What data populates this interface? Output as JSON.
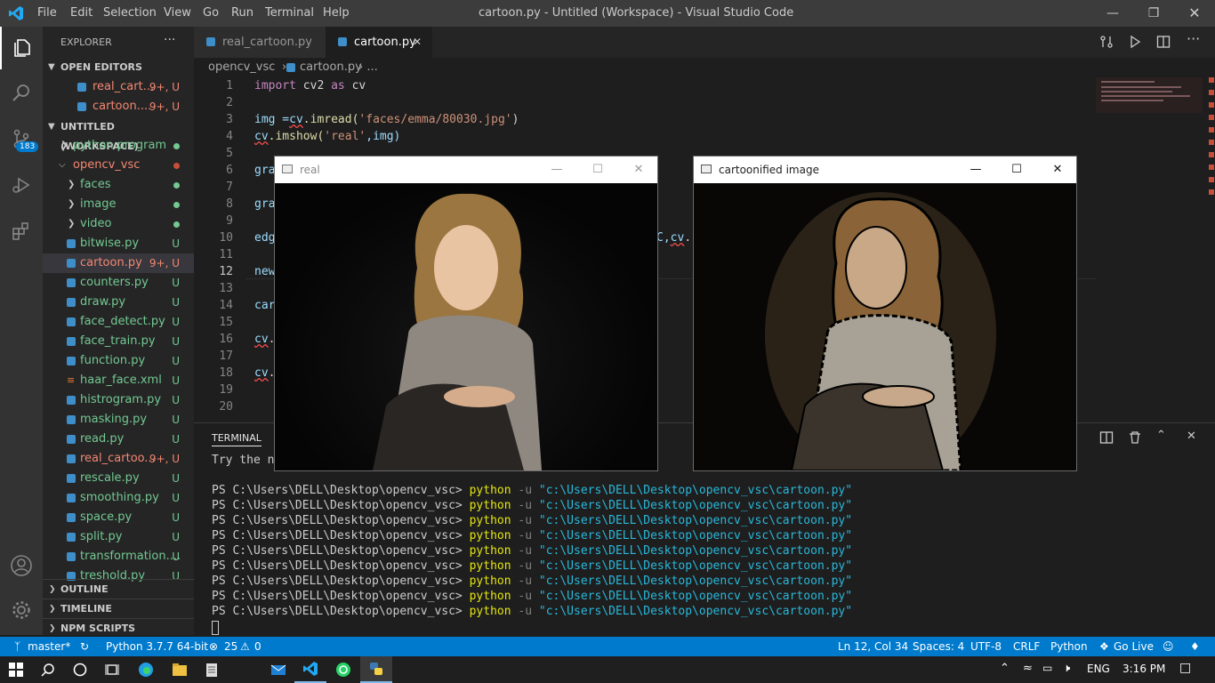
{
  "titlebar": {
    "menus": [
      "File",
      "Edit",
      "Selection",
      "View",
      "Go",
      "Run",
      "Terminal",
      "Help"
    ],
    "title": "cartoon.py - Untitled (Workspace) - Visual Studio Code"
  },
  "activity": {
    "scm_badge": "183"
  },
  "sidebar": {
    "explorer_title": "EXPLORER",
    "explorer_more": "···",
    "open_editors_title": "OPEN EDITORS",
    "open_editors": [
      {
        "name": "real_cart...",
        "status": "9+, U"
      },
      {
        "name": "cartoon....",
        "status": "9+, U"
      }
    ],
    "workspace_title": "UNTITLED (WORKSPACE)",
    "folders": [
      {
        "name": "python program"
      },
      {
        "name": "opencv_vsc"
      },
      {
        "name": "faces"
      },
      {
        "name": "image"
      },
      {
        "name": "video"
      }
    ],
    "files": [
      {
        "name": "bitwise.py",
        "status": "U"
      },
      {
        "name": "cartoon.py",
        "status": "9+, U"
      },
      {
        "name": "counters.py",
        "status": "U"
      },
      {
        "name": "draw.py",
        "status": "U"
      },
      {
        "name": "face_detect.py",
        "status": "U"
      },
      {
        "name": "face_train.py",
        "status": "U"
      },
      {
        "name": "function.py",
        "status": "U"
      },
      {
        "name": "haar_face.xml",
        "status": "U"
      },
      {
        "name": "histrogram.py",
        "status": "U"
      },
      {
        "name": "masking.py",
        "status": "U"
      },
      {
        "name": "read.py",
        "status": "U"
      },
      {
        "name": "real_cartoo...",
        "status": "9+, U"
      },
      {
        "name": "rescale.py",
        "status": "U"
      },
      {
        "name": "smoothing.py",
        "status": "U"
      },
      {
        "name": "space.py",
        "status": "U"
      },
      {
        "name": "split.py",
        "status": "U"
      },
      {
        "name": "transformation....",
        "status": "U"
      },
      {
        "name": "treshold.py",
        "status": "U"
      }
    ],
    "outline": "OUTLINE",
    "timeline": "TIMELINE",
    "npm": "NPM SCRIPTS"
  },
  "tabs": [
    {
      "name": "real_cartoon.py"
    },
    {
      "name": "cartoon.py",
      "close": "✕"
    }
  ],
  "breadcrumb": {
    "folder": "opencv_vsc",
    "sep": "›",
    "file": "cartoon.py",
    "tail": "›  ..."
  },
  "editor": {
    "line_numbers": [
      "1",
      "2",
      "3",
      "4",
      "5",
      "6",
      "7",
      "8",
      "9",
      "10",
      "11",
      "12",
      "13",
      "14",
      "15",
      "16",
      "17",
      "18",
      "19",
      "20"
    ],
    "line1": {
      "kw1": "import",
      "mod": " cv2 ",
      "kw2": "as",
      "alias": " cv"
    },
    "line3": {
      "pre": "img =",
      "cv": "cv",
      "mid": ".imread(",
      "str": "'faces/emma/80030.jpg'",
      "end": ")"
    },
    "line4": {
      "cv": "cv",
      "mid": ".imshow(",
      "str": "'real'",
      "end": ",img)"
    },
    "line6": "gra",
    "line8": "gra",
    "line10": "edg",
    "line10_tail_pre": "C,",
    "line10_tail_cv": "cv",
    "line10_tail_end": ".",
    "line12": "new",
    "line14": "car",
    "line16_cv": "cv",
    "line16_end": ".",
    "line18_cv": "cv",
    "line18_end": "."
  },
  "terminal": {
    "tab": "TERMINAL",
    "hint": "Try the ne",
    "prompt": "PS C:\\Users\\DELL\\Desktop\\opencv_vsc> ",
    "cmd": "python",
    "flag": " -u ",
    "path": "\"c:\\Users\\DELL\\Desktop\\opencv_vsc\\cartoon.py\"",
    "lines": 9
  },
  "windows": {
    "real": {
      "title": "real"
    },
    "cartoon": {
      "title": "cartoonified image"
    }
  },
  "statusbar": {
    "branch": "master*",
    "python": "Python 3.7.7 64-bit",
    "problems": "25",
    "warnings": "0",
    "position": "Ln 12, Col 34",
    "spaces": "Spaces: 4",
    "encoding": "UTF-8",
    "eol": "CRLF",
    "language": "Python",
    "golive": "Go Live"
  },
  "taskbar": {
    "lang": "ENG",
    "time": "3:16 PM"
  },
  "colors": {
    "accent": "#007acc",
    "untracked": "#73c991",
    "modified": "#f48771"
  }
}
